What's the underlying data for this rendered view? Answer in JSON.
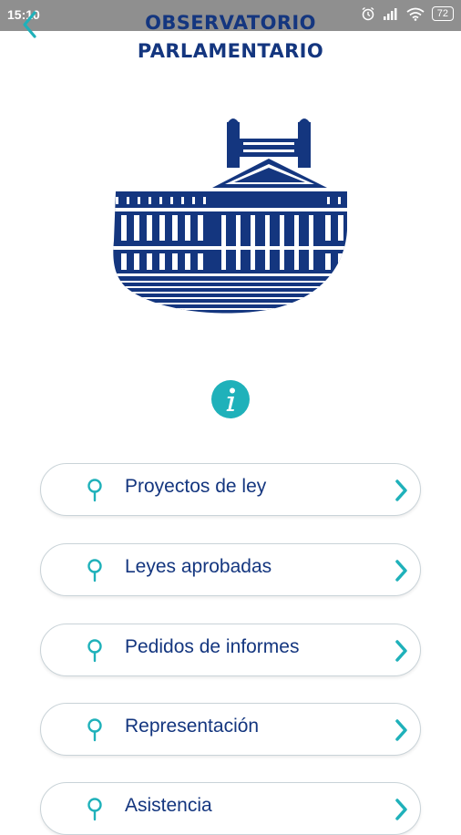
{
  "status_bar": {
    "time": "15:10",
    "battery": "72",
    "icons": [
      "alarm-icon",
      "signal-icon",
      "wifi-icon",
      "battery-icon"
    ]
  },
  "header": {
    "title_line1": "OBSERVATORIO",
    "title_line2": "PARLAMENTARIO"
  },
  "colors": {
    "brand_navy": "#14367f",
    "accent_teal": "#1fb1ba",
    "status_bar": "#8f8f8f",
    "border": "#c9d3d8"
  },
  "menu": {
    "items": [
      {
        "label": "Proyectos de ley"
      },
      {
        "label": "Leyes aprobadas"
      },
      {
        "label": "Pedidos de informes"
      },
      {
        "label": "Representación"
      },
      {
        "label": "Asistencia"
      }
    ]
  }
}
